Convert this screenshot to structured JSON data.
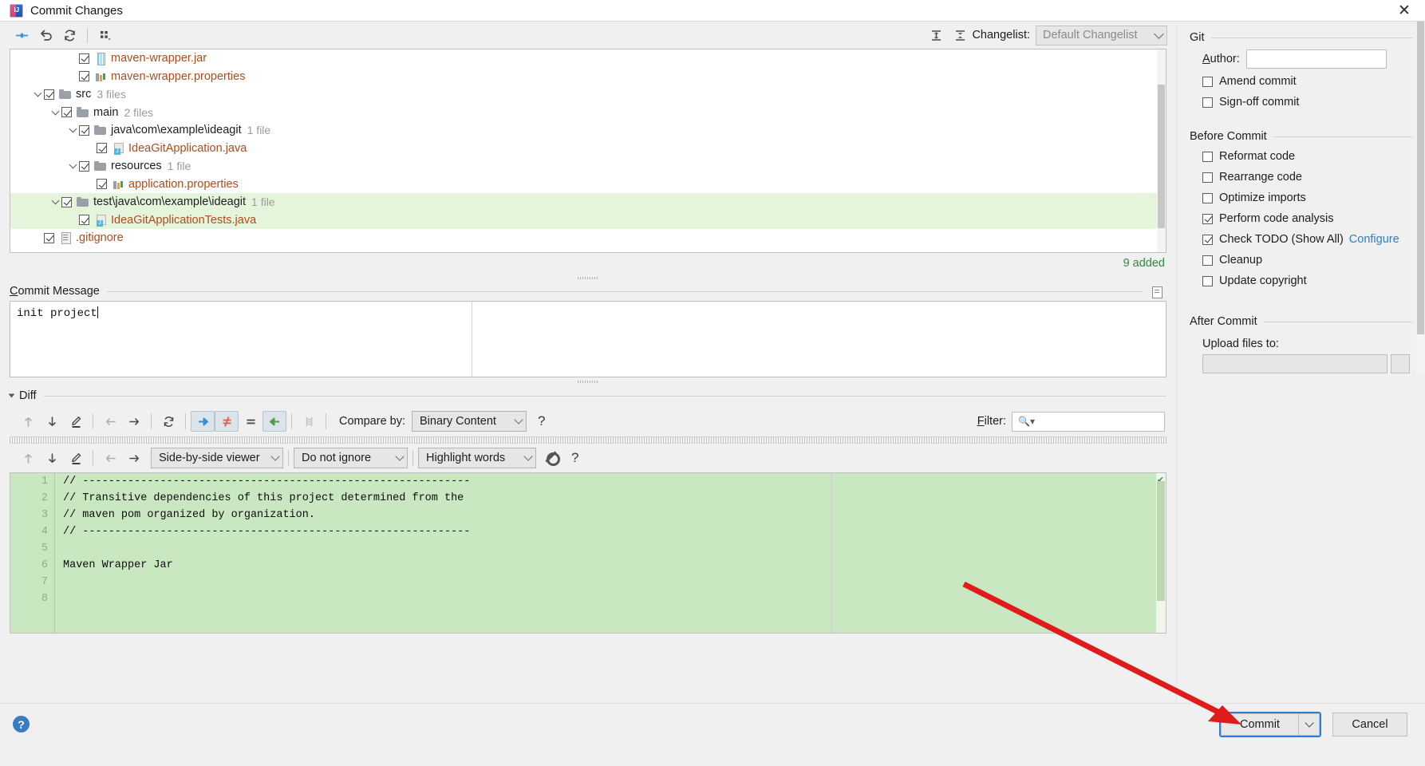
{
  "window": {
    "title": "Commit Changes",
    "app_icon": "intellij-idea-icon",
    "close_label": "✕"
  },
  "toolbar": {
    "icons": [
      {
        "name": "group-by-icon",
        "label": "Group By"
      },
      {
        "name": "revert-icon",
        "label": "Revert"
      },
      {
        "name": "refresh-icon",
        "label": "Refresh"
      },
      {
        "name": "group-options-icon",
        "label": "Group Options"
      }
    ],
    "expand_all": "expand-all-icon",
    "collapse_all": "collapse-all-icon",
    "changelist_label": "Changelist:",
    "changelist_value": "Default Changelist"
  },
  "tree": {
    "rows": [
      {
        "indent": 3,
        "arrow": false,
        "checked": true,
        "icon": "jar-file-icon",
        "name": "maven-wrapper.jar",
        "kind": "file",
        "count": "",
        "selected": false
      },
      {
        "indent": 3,
        "arrow": false,
        "checked": true,
        "icon": "properties-file-icon",
        "name": "maven-wrapper.properties",
        "kind": "file",
        "count": "",
        "selected": false
      },
      {
        "indent": 1,
        "arrow": true,
        "checked": true,
        "icon": "folder-icon",
        "name": "src",
        "kind": "dir",
        "count": "3 files",
        "selected": false
      },
      {
        "indent": 2,
        "arrow": true,
        "checked": true,
        "icon": "folder-icon",
        "name": "main",
        "kind": "dir",
        "count": "2 files",
        "selected": false
      },
      {
        "indent": 3,
        "arrow": true,
        "checked": true,
        "icon": "folder-icon",
        "name": "java\\com\\example\\ideagit",
        "kind": "dir",
        "count": "1 file",
        "selected": false
      },
      {
        "indent": 4,
        "arrow": false,
        "checked": true,
        "icon": "java-file-icon",
        "name": "IdeaGitApplication.java",
        "kind": "file",
        "count": "",
        "selected": false
      },
      {
        "indent": 3,
        "arrow": true,
        "checked": true,
        "icon": "folder-icon",
        "name": "resources",
        "kind": "dir",
        "count": "1 file",
        "selected": false
      },
      {
        "indent": 4,
        "arrow": false,
        "checked": true,
        "icon": "properties-file-icon",
        "name": "application.properties",
        "kind": "file",
        "count": "",
        "selected": false
      },
      {
        "indent": 2,
        "arrow": true,
        "checked": true,
        "icon": "folder-icon",
        "name": "test\\java\\com\\example\\ideagit",
        "kind": "dir",
        "count": "1 file",
        "selected": true
      },
      {
        "indent": 3,
        "arrow": false,
        "checked": true,
        "icon": "java-file-icon",
        "name": "IdeaGitApplicationTests.java",
        "kind": "file",
        "count": "",
        "selected": true
      },
      {
        "indent": 1,
        "arrow": false,
        "checked": true,
        "icon": "text-file-icon",
        "name": ".gitignore",
        "kind": "file",
        "count": "",
        "selected": false
      }
    ],
    "status": "9 added"
  },
  "commit_message": {
    "title_prefix": "C",
    "title_rest": "ommit Message",
    "value": "init project",
    "history_icon": "commit-history-icon"
  },
  "diff": {
    "section_label": "Diff",
    "toolbar1": {
      "icons": [
        {
          "name": "previous-difference-icon",
          "glyph": "up-arrow",
          "active": false,
          "disabled": true
        },
        {
          "name": "next-difference-icon",
          "glyph": "down-arrow",
          "active": false,
          "disabled": false
        },
        {
          "name": "edit-source-icon",
          "glyph": "pencil",
          "active": false,
          "disabled": false
        },
        {
          "name": "previous-file-icon",
          "glyph": "left-arrow",
          "active": false,
          "disabled": true
        },
        {
          "name": "next-file-icon",
          "glyph": "right-arrow",
          "active": false,
          "disabled": false
        },
        {
          "name": "refresh-diff-icon",
          "glyph": "refresh",
          "active": false,
          "disabled": false
        },
        {
          "name": "show-added-icon",
          "glyph": "blue-right-arrow",
          "active": true,
          "disabled": false
        },
        {
          "name": "show-modified-icon",
          "glyph": "not-equal",
          "active": true,
          "disabled": false
        },
        {
          "name": "show-equal-icon",
          "glyph": "equals",
          "active": false,
          "disabled": false
        },
        {
          "name": "show-deleted-icon",
          "glyph": "green-left-arrow",
          "active": true,
          "disabled": false
        },
        {
          "name": "collapse-unchanged-icon",
          "glyph": "collapse",
          "active": false,
          "disabled": true
        }
      ],
      "compare_by_label": "Compare by:",
      "compare_by_value": "Binary Content",
      "help": "?"
    },
    "filter_label": "Filter:",
    "filter_value": "",
    "search_icon": "search-icon",
    "toolbar2": {
      "icons": [
        {
          "name": "previous-difference-icon",
          "glyph": "up-arrow",
          "disabled": true
        },
        {
          "name": "next-difference-icon",
          "glyph": "down-arrow",
          "disabled": false
        },
        {
          "name": "edit-source-icon",
          "glyph": "pencil",
          "disabled": false
        },
        {
          "name": "previous-change-icon",
          "glyph": "left-arrow",
          "disabled": true
        },
        {
          "name": "next-change-icon",
          "glyph": "right-arrow",
          "disabled": false
        }
      ],
      "viewer_mode": "Side-by-side viewer",
      "ignore_mode": "Do not ignore",
      "highlight_mode": "Highlight words",
      "settings_icon": "gear-icon",
      "help": "?"
    },
    "line_numbers": [
      "1",
      "2",
      "3",
      "4",
      "5",
      "6",
      "7",
      "8"
    ],
    "code_lines": [
      "// ------------------------------------------------------------",
      "// Transitive dependencies of this project determined from the",
      "// maven pom organized by organization.",
      "// ------------------------------------------------------------",
      "",
      "Maven Wrapper Jar",
      "",
      ""
    ]
  },
  "right_panel": {
    "git": {
      "title": "Git",
      "author_label_prefix": "A",
      "author_label_rest": "uthor:",
      "author_value": "",
      "checkboxes": [
        {
          "name": "amend-commit",
          "label": "Amend commit",
          "checked": false
        },
        {
          "name": "sign-off-commit",
          "label": "Sign-off commit",
          "checked": false
        }
      ]
    },
    "before_commit": {
      "title": "Before Commit",
      "checkboxes": [
        {
          "name": "reformat-code",
          "label": "Reformat code",
          "checked": false,
          "link": ""
        },
        {
          "name": "rearrange-code",
          "label": "Rearrange code",
          "checked": false,
          "link": ""
        },
        {
          "name": "optimize-imports",
          "label": "Optimize imports",
          "checked": false,
          "link": ""
        },
        {
          "name": "perform-code-analysis",
          "label": "Perform code analysis",
          "checked": true,
          "link": ""
        },
        {
          "name": "check-todo",
          "label": "Check TODO (Show All)",
          "checked": true,
          "link": "Configure"
        },
        {
          "name": "cleanup",
          "label": "Cleanup",
          "checked": false,
          "link": ""
        },
        {
          "name": "update-copyright",
          "label": "Update copyright",
          "checked": false,
          "link": ""
        }
      ]
    },
    "after_commit": {
      "title": "After Commit",
      "upload_label": "Upload files to:",
      "upload_value": ""
    }
  },
  "footer": {
    "help": "?",
    "commit_label": "Commit",
    "commit_dropdown": "commit-options-icon",
    "cancel_label": "Cancel"
  },
  "colors": {
    "accent_blue": "#2d7dd2",
    "file_orange": "#b24a1c",
    "added_green": "#2f8b39",
    "diff_green_bg": "#c9e7c0",
    "selection_green": "#e5f5dc",
    "link_blue": "#2e7dc4",
    "annotation_red": "#e01b1b"
  }
}
